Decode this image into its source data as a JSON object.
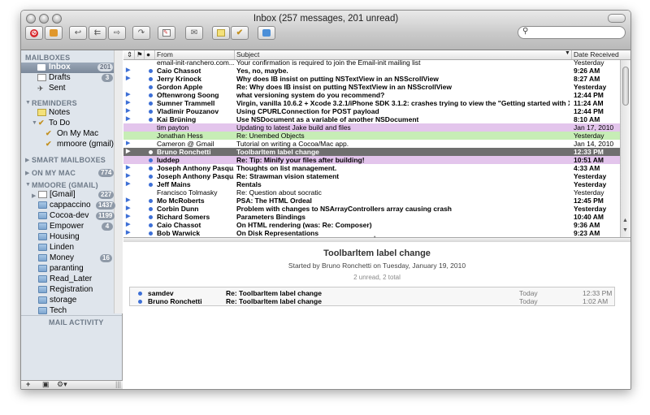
{
  "window": {
    "title": "Inbox (257 messages, 201 unread)"
  },
  "search": {
    "placeholder": ""
  },
  "sidebar": {
    "mailboxes_header": "MAILBOXES",
    "inbox": {
      "label": "Inbox",
      "badge": "201"
    },
    "drafts": {
      "label": "Drafts",
      "badge": "3"
    },
    "sent": {
      "label": "Sent"
    },
    "reminders_header": "REMINDERS",
    "notes": {
      "label": "Notes"
    },
    "todo": {
      "label": "To Do"
    },
    "on_my_mac_todo": {
      "label": "On My Mac"
    },
    "mmoore_gmail_todo": {
      "label": "mmoore (gmail)"
    },
    "smart_header": "SMART MAILBOXES",
    "onmymac_header": "ON MY MAC",
    "onmymac_badge": "774",
    "mmoore_header": "MMOORE (GMAIL)",
    "folders": [
      {
        "label": "[Gmail]",
        "badge": "227"
      },
      {
        "label": "cappaccino",
        "badge": "1437"
      },
      {
        "label": "Cocoa-dev",
        "badge": "1199"
      },
      {
        "label": "Empower",
        "badge": "4"
      },
      {
        "label": "Housing",
        "badge": ""
      },
      {
        "label": "Linden",
        "badge": ""
      },
      {
        "label": "Money",
        "badge": "16"
      },
      {
        "label": "paranting",
        "badge": ""
      },
      {
        "label": "Read_Later",
        "badge": ""
      },
      {
        "label": "Registration",
        "badge": ""
      },
      {
        "label": "storage",
        "badge": ""
      },
      {
        "label": "Tech",
        "badge": ""
      }
    ],
    "mail_activity": "MAIL ACTIVITY"
  },
  "list": {
    "col_from": "From",
    "col_subject": "Subject",
    "col_date": "Date Received",
    "rows": [
      {
        "from": "email-init-ranchero.com...",
        "subject": "Your confirmation is required to join the Email-init mailing list",
        "date": "Yesterday",
        "bold": false,
        "dot": false,
        "thread": false,
        "hl": "",
        "sel": false
      },
      {
        "from": "Caio Chassot",
        "subject": "Yes, no, maybe.",
        "date": "9:26 AM",
        "bold": true,
        "dot": true,
        "thread": true,
        "hl": "",
        "sel": false
      },
      {
        "from": "Jerry Krinock",
        "subject": "Why does IB insist on putting NSTextView in an NSScrollView",
        "date": "8:27 AM",
        "bold": true,
        "dot": true,
        "thread": true,
        "hl": "",
        "sel": false
      },
      {
        "from": "Gordon Apple",
        "subject": "Re: Why does IB insist on putting NSTextView in an  NSScrollView",
        "date": "Yesterday",
        "bold": true,
        "dot": true,
        "thread": false,
        "hl": "",
        "sel": false
      },
      {
        "from": "Oftenwrong Soong",
        "subject": "what versioning system do you recommend?",
        "date": "12:44 PM",
        "bold": true,
        "dot": true,
        "thread": true,
        "hl": "",
        "sel": false
      },
      {
        "from": "Sumner Trammell",
        "subject": "Virgin, vanilla 10.6.2 + Xcode 3.2.1/iPhone SDK 3.1.2: crashes trying  to view the \"Getting started with Xcode\"...",
        "date": "11:24 AM",
        "bold": true,
        "dot": true,
        "thread": true,
        "hl": "",
        "sel": false
      },
      {
        "from": "Vladimir Pouzanov",
        "subject": "Using CPURLConnection for POST payload",
        "date": "12:44 PM",
        "bold": true,
        "dot": true,
        "thread": true,
        "hl": "",
        "sel": false
      },
      {
        "from": "Kai Brüning",
        "subject": "Use NSDocument as a variable of another NSDocument",
        "date": "8:10 AM",
        "bold": true,
        "dot": true,
        "thread": true,
        "hl": "",
        "sel": false
      },
      {
        "from": "tim payton",
        "subject": "Updating to latest Jake build and files",
        "date": "Jan 17, 2010",
        "bold": false,
        "dot": false,
        "thread": false,
        "hl": "#e3c5ec",
        "sel": false
      },
      {
        "from": "Jonathan Hess",
        "subject": "Re: Unembed Objects",
        "date": "Yesterday",
        "bold": false,
        "dot": false,
        "thread": false,
        "hl": "#c7edb6",
        "sel": false
      },
      {
        "from": "Cameron @ Gmail",
        "subject": "Tutorial on writing a Cocoa/Mac app.",
        "date": "Jan 14, 2010",
        "bold": false,
        "dot": false,
        "thread": true,
        "hl": "",
        "sel": false
      },
      {
        "from": "Bruno Ronchetti",
        "subject": "Toolbarltem label change",
        "date": "12:33 PM",
        "bold": true,
        "dot": true,
        "thread": true,
        "hl": "",
        "sel": true
      },
      {
        "from": "luddep",
        "subject": "Re: Tip: Minify your files after building!",
        "date": "10:51 AM",
        "bold": true,
        "dot": true,
        "thread": false,
        "hl": "#e3c5ec",
        "sel": false
      },
      {
        "from": "Joseph Anthony Pasqu...",
        "subject": "Thoughts on list management.",
        "date": "4:33 AM",
        "bold": true,
        "dot": true,
        "thread": true,
        "hl": "",
        "sel": false
      },
      {
        "from": "Joseph Anthony Pasqu...",
        "subject": "Re: Strawman vision statement",
        "date": "Yesterday",
        "bold": true,
        "dot": true,
        "thread": true,
        "hl": "",
        "sel": false
      },
      {
        "from": "Jeff Mains",
        "subject": "Rentals",
        "date": "Yesterday",
        "bold": true,
        "dot": true,
        "thread": true,
        "hl": "",
        "sel": false
      },
      {
        "from": "Francisco Tolmasky",
        "subject": "Re: Question about socratic",
        "date": "Yesterday",
        "bold": false,
        "dot": false,
        "thread": false,
        "hl": "",
        "sel": false
      },
      {
        "from": "Mo McRoberts",
        "subject": "PSA: The HTML Ordeal",
        "date": "12:45 PM",
        "bold": true,
        "dot": true,
        "thread": true,
        "hl": "",
        "sel": false
      },
      {
        "from": "Corbin Dunn",
        "subject": "Problem with changes to NSArrayControllers array causing crash",
        "date": "Yesterday",
        "bold": true,
        "dot": true,
        "thread": true,
        "hl": "",
        "sel": false
      },
      {
        "from": "Richard Somers",
        "subject": "Parameters Bindings",
        "date": "10:40 AM",
        "bold": true,
        "dot": true,
        "thread": true,
        "hl": "",
        "sel": false
      },
      {
        "from": "Caio Chassot",
        "subject": "On HTML rendering (was: Re: Composer)",
        "date": "9:36 AM",
        "bold": true,
        "dot": true,
        "thread": true,
        "hl": "",
        "sel": false
      },
      {
        "from": "Bob Warwick",
        "subject": "On Disk Representations",
        "date": "9:23 AM",
        "bold": true,
        "dot": true,
        "thread": true,
        "hl": "",
        "sel": false
      },
      {
        "from": "Tom Robinson",
        "subject": "Re: NSSound for Cappuccino",
        "date": "Yesterday",
        "bold": false,
        "dot": false,
        "thread": false,
        "hl": "",
        "sel": false
      }
    ]
  },
  "preview": {
    "title": "Toolbarltem label change",
    "subtitle": "Started by Bruno Ronchetti on Tuesday, January 19, 2010",
    "count": "2 unread, 2 total",
    "messages": [
      {
        "from": "samdev",
        "subject": "Re: Toolbarltem label change",
        "day": "Today",
        "time": "12:33 PM"
      },
      {
        "from": "Bruno Ronchetti",
        "subject": "Re: Toolbarltem label change",
        "day": "Today",
        "time": "1:02 AM"
      }
    ]
  },
  "colors": {
    "selection": "#6f6f6f",
    "unread_dot": "#3d6fd6",
    "purple_label": "#e3c5ec",
    "green_label": "#c7edb6",
    "sidebar_bg": "#dfe5ec"
  }
}
